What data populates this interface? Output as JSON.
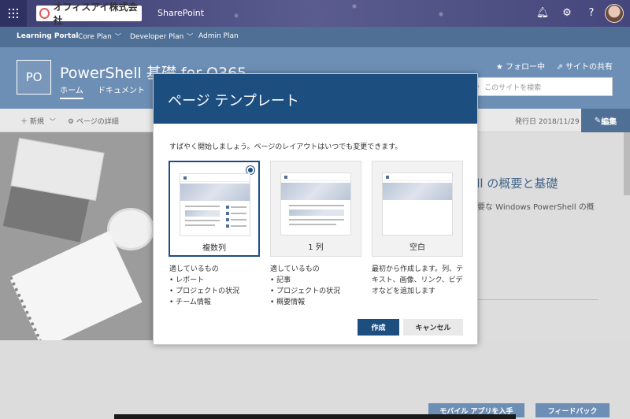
{
  "suitebar": {
    "brand": "オフィスアイ株式会社",
    "app": "SharePoint"
  },
  "nav": {
    "portal": "Learning Portal",
    "items": [
      "Core Plan",
      "Developer Plan",
      "Admin Plan"
    ]
  },
  "site": {
    "logo": "PO",
    "title": "PowerShell 基礎 for O365",
    "tabs": [
      "ホーム",
      "ドキュメント"
    ],
    "follow": "フォロー中",
    "share": "サイトの共有",
    "search_placeholder": "このサイトを検索"
  },
  "commandbar": {
    "new": "新規",
    "details": "ページの詳細",
    "published": "発行日 2018/11/29",
    "edit": "編集"
  },
  "page": {
    "article_title": "ell の概要と基礎",
    "article_sub": "必要な Windows PowerShell の概"
  },
  "footer": {
    "mobile": "モバイル アプリを入手",
    "feedback": "フィードバック"
  },
  "dialog": {
    "title": "ページ テンプレート",
    "intro": "すばやく開始しましょう。ページのレイアウトはいつでも変更できます。",
    "templates": [
      {
        "label": "複数列",
        "selected": true
      },
      {
        "label": "1 列",
        "selected": false
      },
      {
        "label": "空白",
        "selected": false
      }
    ],
    "descriptions": [
      {
        "heading": "適しているもの",
        "rows": [
          "レポート",
          "プロジェクトの状況",
          "チーム情報"
        ]
      },
      {
        "heading": "適しているもの",
        "rows": [
          "記事",
          "プロジェクトの状況",
          "概要情報"
        ]
      },
      {
        "text": "最初から作成します。列、テキスト、画像、リンク、ビデオなどを追加します"
      }
    ],
    "create": "作成",
    "cancel": "キャンセル"
  }
}
